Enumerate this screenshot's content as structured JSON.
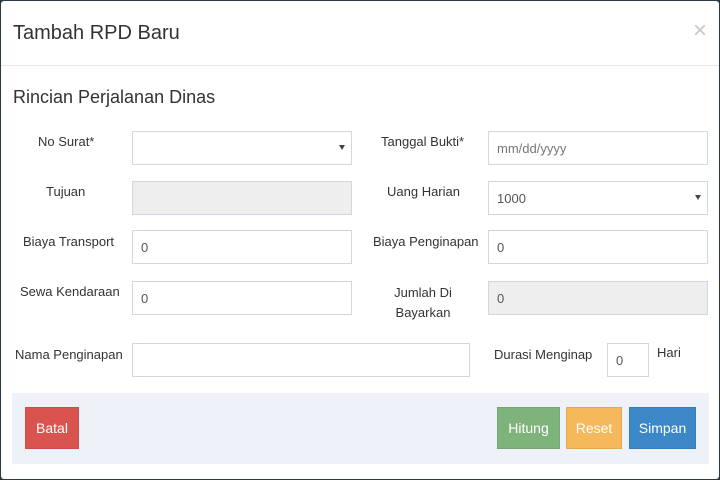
{
  "header": {
    "title": "Tambah RPD Baru",
    "close_icon": "×"
  },
  "section": {
    "title": "Rincian Perjalanan Dinas"
  },
  "form": {
    "no_surat": {
      "label": "No Surat*",
      "value": ""
    },
    "tanggal_bukti": {
      "label": "Tanggal Bukti*",
      "placeholder": "mm/dd/yyyy"
    },
    "tujuan": {
      "label": "Tujuan",
      "value": ""
    },
    "uang_harian": {
      "label": "Uang Harian",
      "value": "1000"
    },
    "biaya_transport": {
      "label": "Biaya Transport",
      "value": "0"
    },
    "biaya_penginapan": {
      "label": "Biaya Penginapan",
      "value": "0"
    },
    "sewa_kendaraan": {
      "label": "Sewa Kendaraan",
      "value": "0"
    },
    "jumlah_dibayarkan": {
      "label_line1": "Jumlah Di",
      "label_line2": "Bayarkan",
      "value": "0"
    },
    "nama_penginapan": {
      "label": "Nama Penginapan",
      "value": ""
    },
    "durasi_menginap": {
      "label": "Durasi Menginap",
      "value": "0",
      "unit": "Hari"
    }
  },
  "footer": {
    "batal_label": "Batal",
    "hitung_label": "Hitung",
    "reset_label": "Reset",
    "simpan_label": "Simpan"
  },
  "colors": {
    "batal": "#d9534f",
    "hitung": "#7fb37c",
    "reset": "#f5b85a",
    "simpan": "#3b87c7"
  }
}
